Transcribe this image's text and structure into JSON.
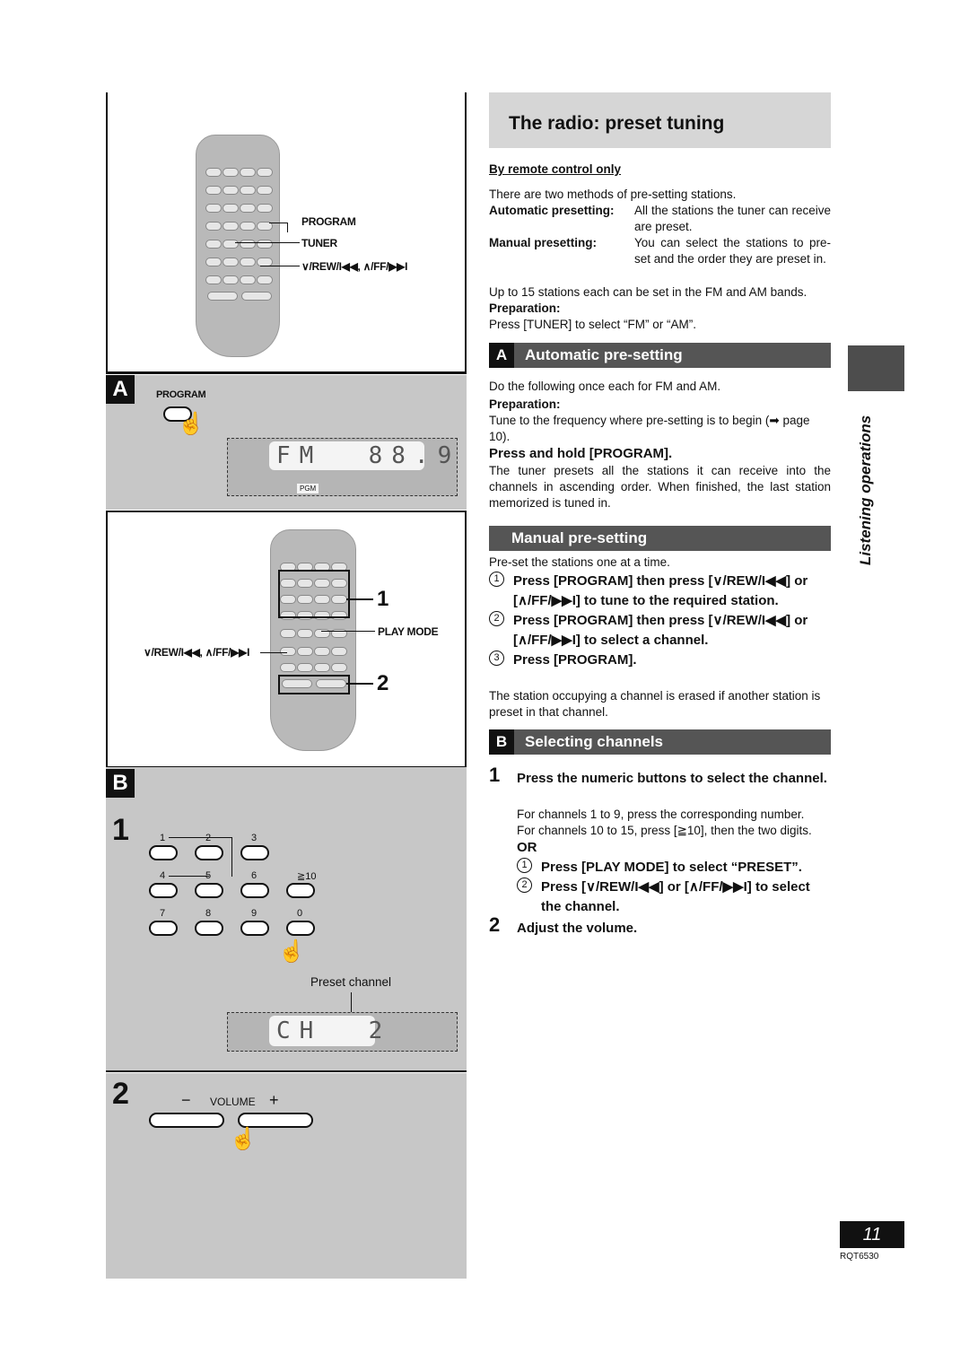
{
  "title": "The radio: preset tuning",
  "subtitle": "By remote control only",
  "intro": {
    "line1": "There are two methods of pre-setting stations.",
    "auto_label": "Automatic presetting:",
    "auto_text": "All the stations the tuner can receive are preset.",
    "manual_label": "Manual presetting:",
    "manual_text": "You can select the stations to pre-set and the order they are preset in.",
    "line2": "Up to 15 stations each can be set in the FM and AM bands.",
    "prep_label": "Preparation:",
    "prep_text": "Press [TUNER] to select “FM” or  “AM”."
  },
  "section_a": {
    "letter": "A",
    "title": "Automatic pre-setting",
    "text1": "Do the following once each for FM and AM.",
    "prep_label": "Preparation:",
    "prep_text": "Tune to the frequency where pre-setting is to begin (➡ page 10).",
    "step": "Press and hold [PROGRAM].",
    "text2": "The tuner presets all the stations it can receive into the channels in ascending order.  When finished, the last station memorized is tuned in."
  },
  "section_manual": {
    "title": "Manual pre-setting",
    "text1": "Pre-set the stations one at a time.",
    "steps": [
      {
        "n": "1",
        "text": "Press [PROGRAM] then press [∨/REW/I◀◀] or [∧/FF/▶▶I] to tune to the required station."
      },
      {
        "n": "2",
        "text": "Press [PROGRAM] then press [∨/REW/I◀◀] or [∧/FF/▶▶I] to select a channel."
      },
      {
        "n": "3",
        "text": "Press [PROGRAM]."
      }
    ],
    "note": "The station occupying a channel is erased if another station is preset in that channel."
  },
  "section_b": {
    "letter": "B",
    "title": "Selecting channels",
    "step1_num": "1",
    "step1": "Press the numeric buttons to select the channel.",
    "step1_text1": "For channels 1 to 9, press the corresponding number.",
    "step1_text2": "For channels 10 to 15, press [≧10], then the two digits.",
    "or": "OR",
    "sub1": "Press [PLAY MODE] to select “PRESET”.",
    "sub2": "Press [∨/REW/I◀◀] or [∧/FF/▶▶I] to select the channel.",
    "step2_num": "2",
    "step2": "Adjust the volume."
  },
  "side_tab": "Listening operations",
  "page_number": "11",
  "doc_code": "RQT6530",
  "figures": {
    "top": {
      "program": "PROGRAM",
      "tuner": "TUNER",
      "rewff": "∨/REW/I◀◀, ∧/FF/▶▶I"
    },
    "a": {
      "letter": "A",
      "program": "PROGRAM",
      "display": "FM  88.9",
      "pgm": "PGM"
    },
    "b_remote": {
      "one": "1",
      "play_mode": "PLAY MODE",
      "rewff": "∨/REW/I◀◀, ∧/FF/▶▶I",
      "two": "2"
    },
    "b": {
      "letter": "B",
      "step1": "1",
      "keys": [
        "1",
        "2",
        "3",
        "4",
        "5",
        "6",
        "≧10",
        "7",
        "8",
        "9",
        "0"
      ],
      "preset_channel": "Preset channel",
      "display": "CH  2",
      "step2": "2",
      "volume": "VOLUME",
      "minus": "−",
      "plus": "+"
    }
  },
  "colors": {
    "panel_gray": "#c7c7c7",
    "header_dark": "#555555",
    "title_box": "#d6d6d6"
  }
}
